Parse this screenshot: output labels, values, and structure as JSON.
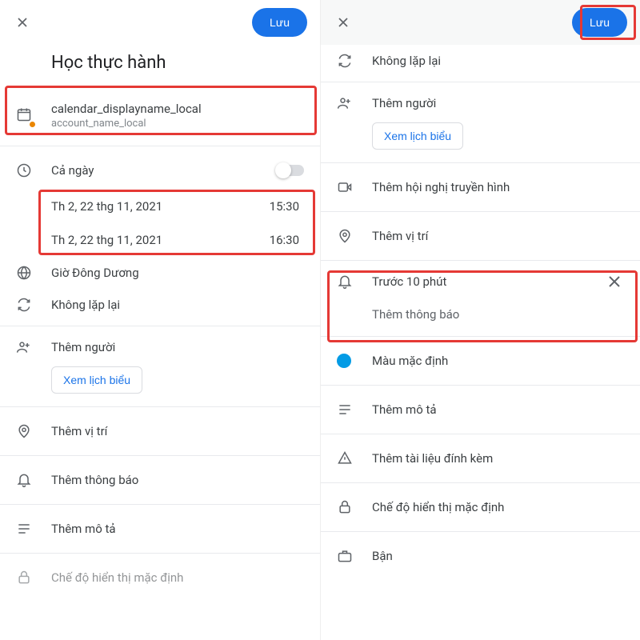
{
  "left": {
    "save": "Lưu",
    "title": "Học thực hành",
    "calendar": {
      "name": "calendar_displayname_local",
      "account": "account_name_local"
    },
    "allday": "Cả ngày",
    "start": {
      "date": "Th 2, 22 thg 11, 2021",
      "time": "15:30"
    },
    "end": {
      "date": "Th 2, 22 thg 11, 2021",
      "time": "16:30"
    },
    "timezone": "Giờ Đông Dương",
    "repeat": "Không lặp lại",
    "addPeople": "Thêm người",
    "viewSchedules": "Xem lịch biểu",
    "addLocation": "Thêm vị trí",
    "addNotification": "Thêm thông báo",
    "addDescription": "Thêm mô tả",
    "visibility": "Chế độ hiển thị mặc định"
  },
  "right": {
    "save": "Lưu",
    "repeat": "Không lặp lại",
    "addPeople": "Thêm người",
    "viewSchedules": "Xem lịch biểu",
    "addVideo": "Thêm hội nghị truyền hình",
    "addLocation": "Thêm vị trí",
    "reminder": "Trước 10 phút",
    "addNotification": "Thêm thông báo",
    "defaultColor": "Màu mặc định",
    "addDescription": "Thêm mô tả",
    "addAttachment": "Thêm tài liệu đính kèm",
    "visibility": "Chế độ hiển thị mặc định",
    "busy": "Bận"
  }
}
